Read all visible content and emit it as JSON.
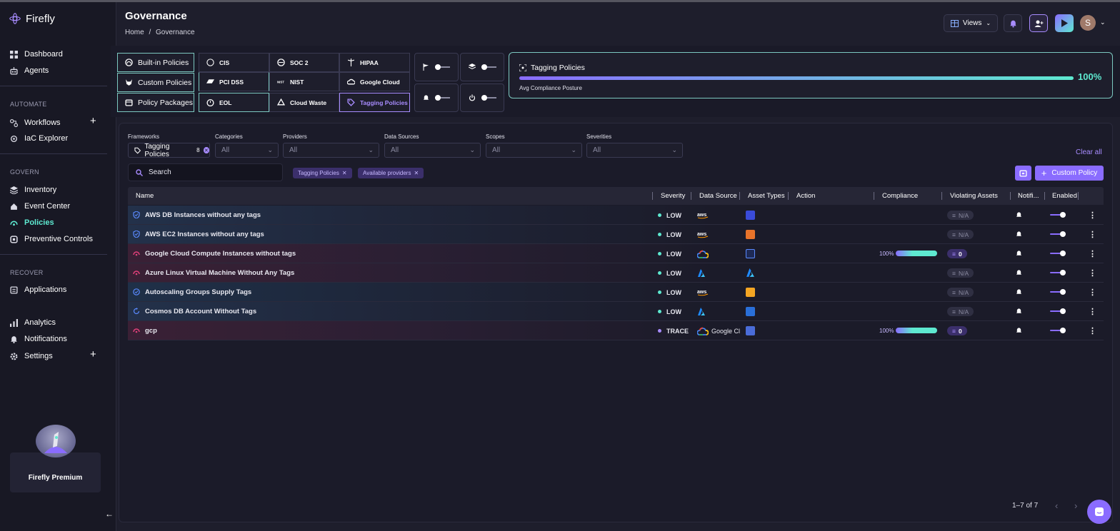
{
  "app": {
    "name": "Firefly"
  },
  "sidebar": {
    "items_top": [
      {
        "label": "Dashboard",
        "icon": "dashboard-icon"
      },
      {
        "label": "Agents",
        "icon": "robot-icon"
      }
    ],
    "sections": [
      {
        "title": "AUTOMATE",
        "items": [
          {
            "label": "Workflows",
            "icon": "workflows-icon"
          },
          {
            "label": "IaC Explorer",
            "icon": "iac-icon"
          }
        ]
      },
      {
        "title": "GOVERN",
        "items": [
          {
            "label": "Inventory",
            "icon": "layers-icon"
          },
          {
            "label": "Event Center",
            "icon": "events-icon"
          },
          {
            "label": "Policies",
            "icon": "policies-icon",
            "active": true
          },
          {
            "label": "Preventive Controls",
            "icon": "shield-icon"
          }
        ]
      },
      {
        "title": "RECOVER",
        "items": [
          {
            "label": "Applications",
            "icon": "apps-icon"
          }
        ]
      }
    ],
    "items_bottom": [
      {
        "label": "Analytics",
        "icon": "analytics-icon"
      },
      {
        "label": "Notifications",
        "icon": "bell-icon"
      },
      {
        "label": "Settings",
        "icon": "gear-icon"
      }
    ],
    "premium": "Firefly Premium"
  },
  "header": {
    "title": "Governance",
    "breadcrumb": [
      "Home",
      "/",
      "Governance"
    ],
    "views_label": "Views",
    "avatar_initial": "S"
  },
  "frameworks": {
    "policy_types": [
      "Built-in Policies",
      "Custom Policies",
      "Policy Packages"
    ],
    "grid": [
      [
        "CIS",
        "SOC 2",
        "HIPAA"
      ],
      [
        "PCI DSS",
        "NIST",
        "Google Cloud"
      ],
      [
        "EOL",
        "Cloud Waste",
        "Tagging Policies"
      ]
    ],
    "selected": "Tagging Policies"
  },
  "posture": {
    "title": "Tagging Policies",
    "percent": "100%",
    "subtitle": "Avg Compliance Posture",
    "fill": 1.0
  },
  "filters": {
    "labels": [
      "Frameworks",
      "Categories",
      "Providers",
      "Data Sources",
      "Scopes",
      "Severities"
    ],
    "framework_value": "Tagging Policies",
    "framework_count": "8",
    "all": "All",
    "clear_all": "Clear all"
  },
  "search": {
    "placeholder": "Search"
  },
  "chips": [
    "Tagging Policies",
    "Available providers"
  ],
  "custom_policy_label": "Custom Policy",
  "table": {
    "headers": [
      "Name",
      "Severity",
      "Data Source",
      "Asset Types",
      "Action",
      "Compliance",
      "Violating Assets",
      "Notifi...",
      "Enabled"
    ],
    "rows": [
      {
        "name": "AWS DB Instances without any tags",
        "severity": "LOW",
        "source": "aws",
        "source_label": "",
        "violating": "N/A",
        "compliance": ""
      },
      {
        "name": "AWS EC2 Instances without any tags",
        "severity": "LOW",
        "source": "aws",
        "source_label": "",
        "violating": "N/A",
        "compliance": ""
      },
      {
        "name": "Google Cloud Compute Instances without tags",
        "severity": "LOW",
        "source": "gcp",
        "source_label": "",
        "violating": "0",
        "compliance": "100%"
      },
      {
        "name": "Azure Linux Virtual Machine Without Any Tags",
        "severity": "LOW",
        "source": "azure",
        "source_label": "",
        "violating": "N/A",
        "compliance": ""
      },
      {
        "name": "Autoscaling Groups Supply Tags",
        "severity": "LOW",
        "source": "aws",
        "source_label": "",
        "violating": "N/A",
        "compliance": ""
      },
      {
        "name": "Cosmos DB Account Without Tags",
        "severity": "LOW",
        "source": "azure",
        "source_label": "",
        "violating": "N/A",
        "compliance": ""
      },
      {
        "name": "gcp",
        "severity": "TRACE",
        "source": "gcp",
        "source_label": "Google Cl",
        "violating": "0",
        "compliance": "100%"
      }
    ]
  },
  "pagination": {
    "label": "1–7 of 7"
  },
  "colors": {
    "accent": "#8a6cff",
    "teal": "#5ee9d0",
    "low": "#5ee9d0",
    "trace": "#a88cff"
  }
}
